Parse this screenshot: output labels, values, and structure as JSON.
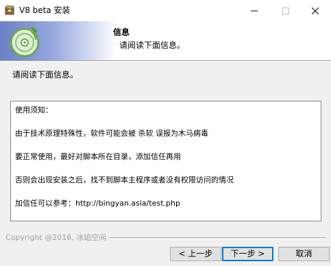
{
  "window": {
    "title": "V8 beta 安装"
  },
  "titlebar_controls": {
    "minimize_icon": "minimize-icon",
    "maximize_icon": "maximize-icon",
    "close_icon": "close-icon"
  },
  "header": {
    "title": "信息",
    "subtitle": "请阅读下面信息。",
    "logo_icon": "install-disc-icon"
  },
  "body": {
    "intro": "请阅读下面信息。",
    "info_lines": [
      "使用须知：",
      "由于技术原理特殊性，软件可能会被 杀软 误报为木马病毒",
      "要正常使用，最好对脚本所在目录，添加信任再用",
      "否则会出现安装之后，找不到脚本主程序或者没有权限访问的情况",
      "加信任可以参考：http://bingyan.asia/test.php"
    ]
  },
  "footer": {
    "branding": "Copyright @2016, 冰焰空间",
    "back_label": "< 上一步",
    "next_label": "下一步 >",
    "cancel_label": "取消"
  },
  "colors": {
    "header_gradient_start": "#6b7fc6",
    "dialog_bg": "#f0f0f0",
    "default_button_border": "#0078d7",
    "logo_green": "#6aa84f"
  }
}
